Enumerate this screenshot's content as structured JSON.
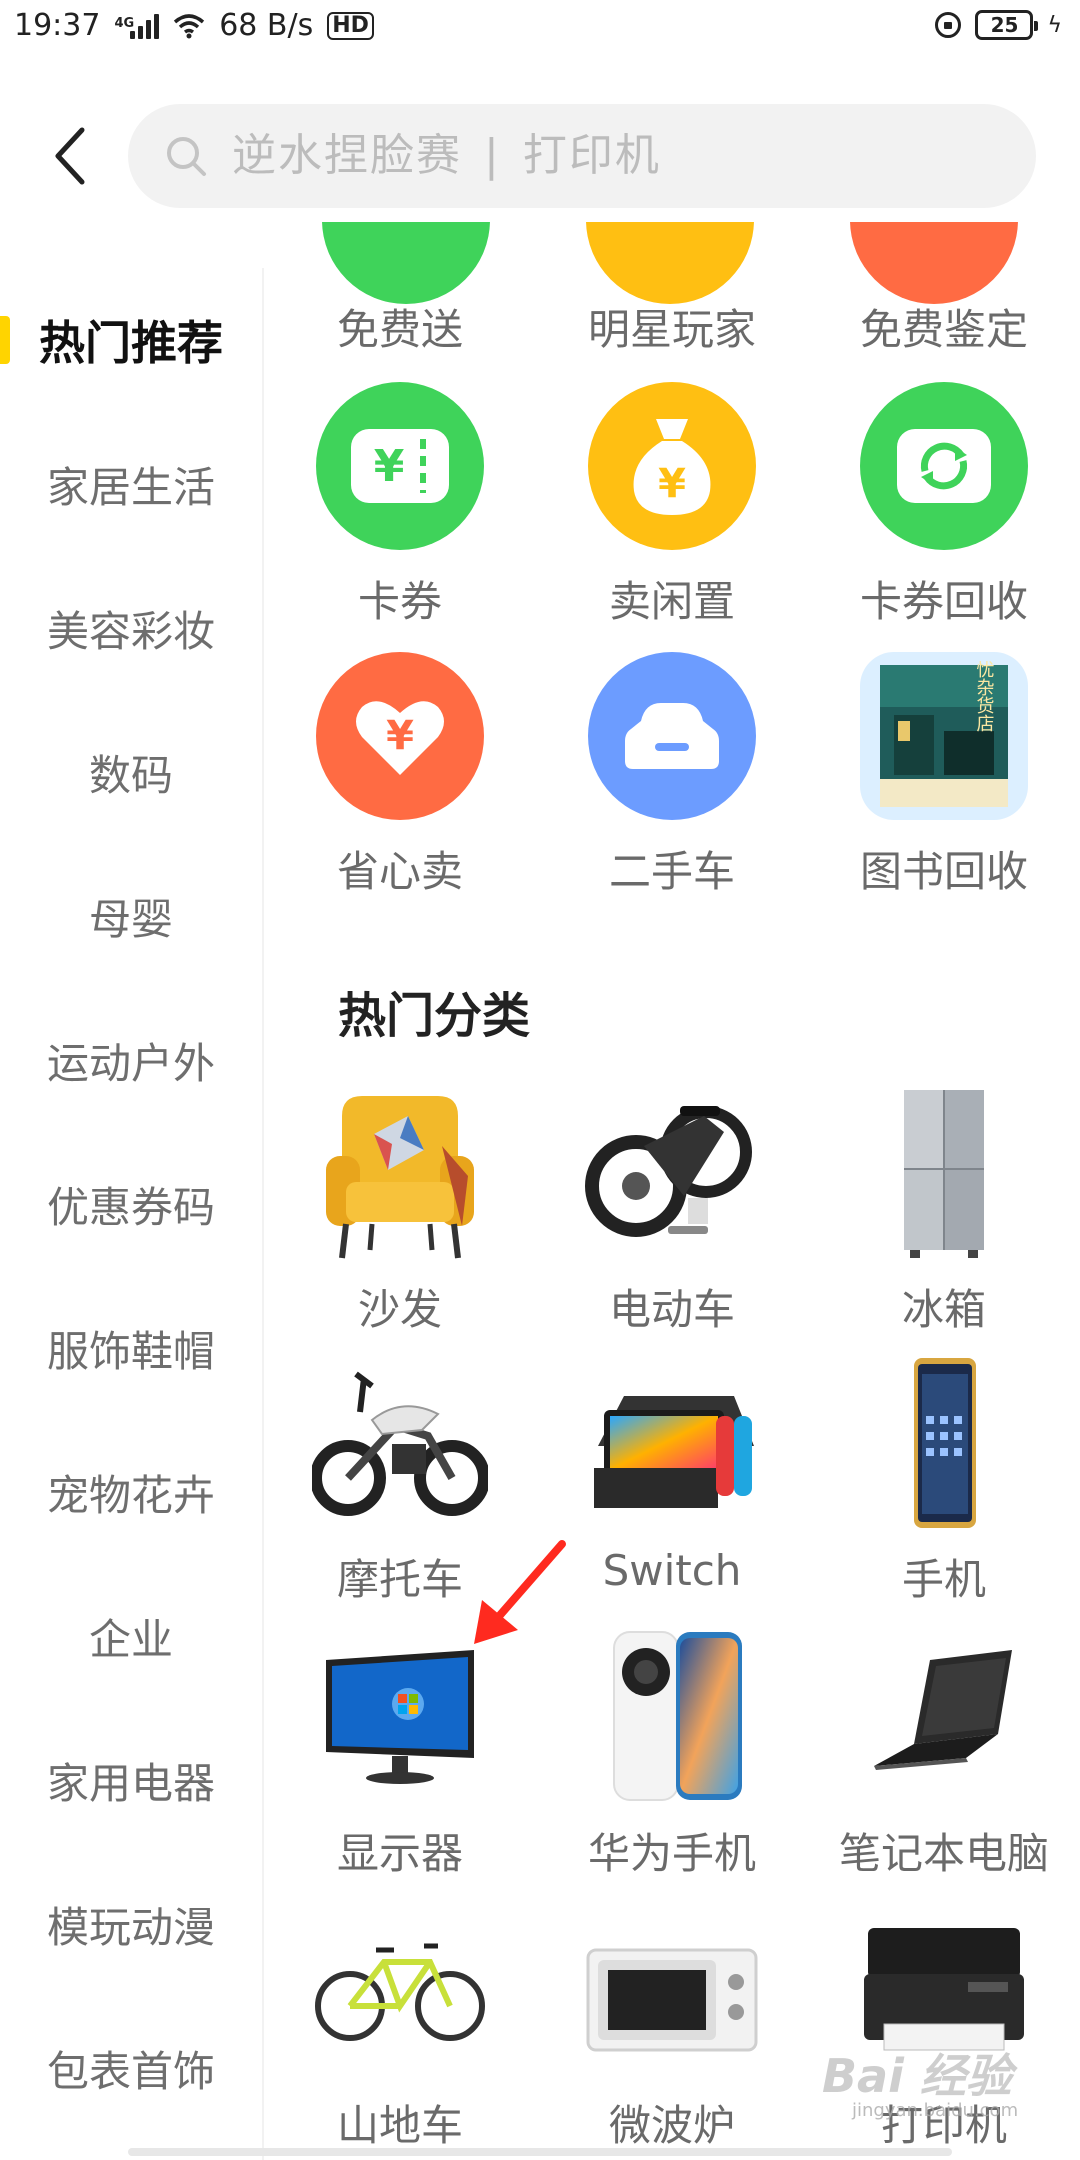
{
  "status_bar": {
    "time": "19:37",
    "network": "4G",
    "speed": "68 B/s",
    "hd": "HD",
    "battery": "25"
  },
  "search": {
    "placeholder_main": "逆水捏脸赛",
    "placeholder_sep": "|",
    "placeholder_hint": "打印机"
  },
  "sidebar": {
    "items": [
      {
        "label": "热门推荐",
        "active": true
      },
      {
        "label": "家居生活"
      },
      {
        "label": "美容彩妆"
      },
      {
        "label": "数码"
      },
      {
        "label": "母婴"
      },
      {
        "label": "运动户外"
      },
      {
        "label": "优惠券码"
      },
      {
        "label": "服饰鞋帽"
      },
      {
        "label": "宠物花卉"
      },
      {
        "label": "企业"
      },
      {
        "label": "家用电器"
      },
      {
        "label": "模玩动漫"
      },
      {
        "label": "包表首饰"
      }
    ]
  },
  "services": {
    "row0": [
      "免费送",
      "明星玩家",
      "免费鉴定"
    ],
    "row1": [
      "卡券",
      "卖闲置",
      "卡券回收"
    ],
    "row2": [
      "省心卖",
      "二手车",
      "图书回收"
    ],
    "book_cover_text": "解忧杂货店"
  },
  "hot_categories": {
    "title": "热门分类",
    "items": [
      "沙发",
      "电动车",
      "冰箱",
      "摩托车",
      "Switch",
      "手机",
      "显示器",
      "华为手机",
      "笔记本电脑",
      "山地车",
      "微波炉",
      "打印机"
    ]
  },
  "colors": {
    "green": "#3fd35a",
    "yellow": "#ffbf12",
    "orange": "#ff6b43",
    "blue": "#6c9cff",
    "accent": "#ffd400",
    "arrow": "#ff2a1f"
  },
  "watermark": {
    "main": "Bai 经验",
    "sub": "jingyan.baidu.com"
  }
}
